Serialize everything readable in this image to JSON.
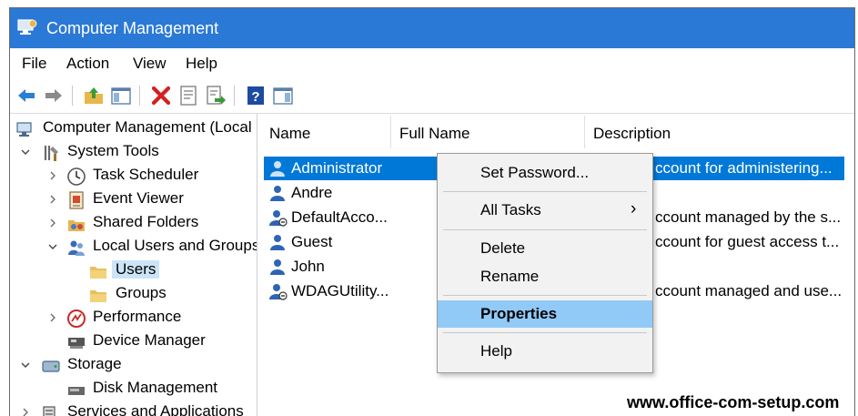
{
  "window": {
    "title": "Computer Management"
  },
  "menu": [
    "File",
    "Action",
    "View",
    "Help"
  ],
  "toolbar": {
    "icons": [
      "back-arrow-icon",
      "forward-arrow-icon",
      "up-folder-icon",
      "show-hide-tree-icon",
      "delete-icon",
      "properties-icon",
      "export-list-icon",
      "help-icon",
      "show-hide-action-pane-icon"
    ]
  },
  "tree": {
    "root": "Computer Management (Local",
    "system_tools": "System Tools",
    "task_scheduler": "Task Scheduler",
    "event_viewer": "Event Viewer",
    "shared_folders": "Shared Folders",
    "local_users_groups": "Local Users and Groups",
    "users": "Users",
    "groups": "Groups",
    "performance": "Performance",
    "device_manager": "Device Manager",
    "storage": "Storage",
    "disk_management": "Disk Management",
    "services_apps": "Services and Applications"
  },
  "list": {
    "columns": {
      "name": "Name",
      "full_name": "Full Name",
      "description": "Description"
    },
    "rows": [
      {
        "name": "Administrator",
        "description": "ccount for administering..."
      },
      {
        "name": "Andre",
        "description": ""
      },
      {
        "name": "DefaultAcco...",
        "description": "ccount managed by the s..."
      },
      {
        "name": "Guest",
        "description": "ccount for guest access t..."
      },
      {
        "name": "John",
        "description": ""
      },
      {
        "name": "WDAGUtility...",
        "description": "ccount managed and use..."
      }
    ]
  },
  "context_menu": {
    "set_password": "Set Password...",
    "all_tasks": "All Tasks",
    "delete": "Delete",
    "rename": "Rename",
    "properties": "Properties",
    "help": "Help",
    "submenu_arrow": "›"
  },
  "watermark": "www.office-com-setup.com",
  "colors": {
    "titlebar": "#2b79d6",
    "selection": "#0078d7",
    "menu_highlight": "#91c9f7"
  }
}
